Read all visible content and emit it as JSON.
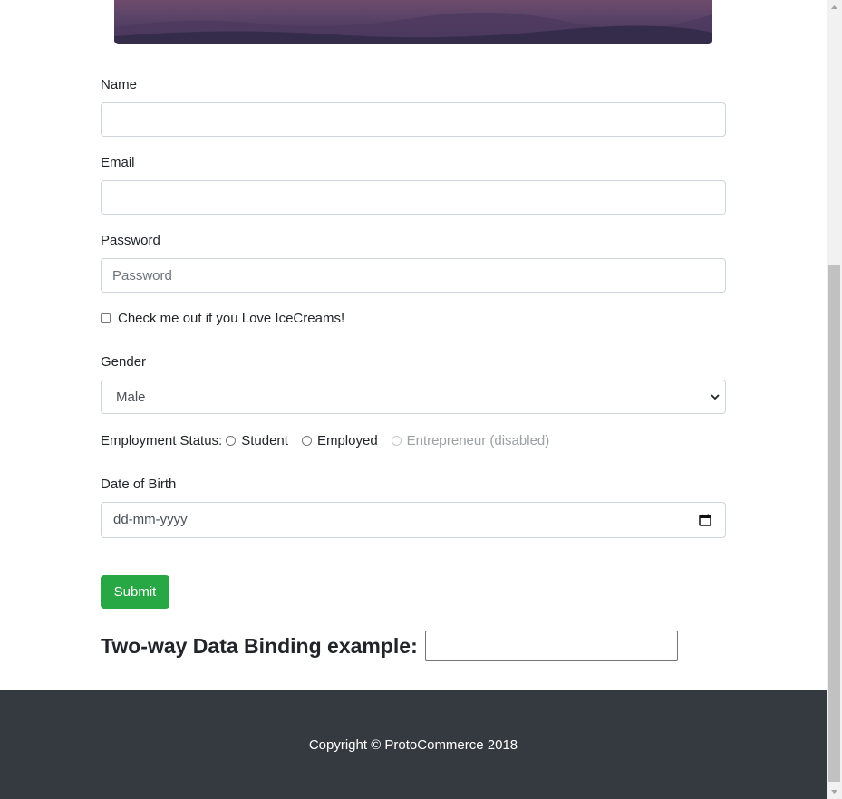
{
  "form": {
    "name_label": "Name",
    "name_value": "",
    "email_label": "Email",
    "email_value": "",
    "password_label": "Password",
    "password_placeholder": "Password",
    "icecream_label": "Check me out if you Love IceCreams!",
    "icecream_checked": false,
    "gender_label": "Gender",
    "gender_selected": "Male",
    "employment_label": "Employment Status:",
    "employment_options": [
      {
        "label": "Student",
        "disabled": false
      },
      {
        "label": "Employed",
        "disabled": false
      },
      {
        "label": "Entrepreneur (disabled)",
        "disabled": true
      }
    ],
    "dob_label": "Date of Birth",
    "dob_placeholder": "dd-mm-yyyy",
    "submit_label": "Submit"
  },
  "binding": {
    "label": "Two-way Data Binding example:",
    "value": ""
  },
  "footer": {
    "copyright": "Copyright © ProtoCommerce 2018"
  },
  "colors": {
    "submit": "#28a745",
    "footer_bg": "#343a40",
    "banner": "#5d4568"
  },
  "icons": [
    "chevron-down-icon",
    "calendar-icon",
    "scroll-up-arrow-icon",
    "scroll-down-arrow-icon"
  ]
}
